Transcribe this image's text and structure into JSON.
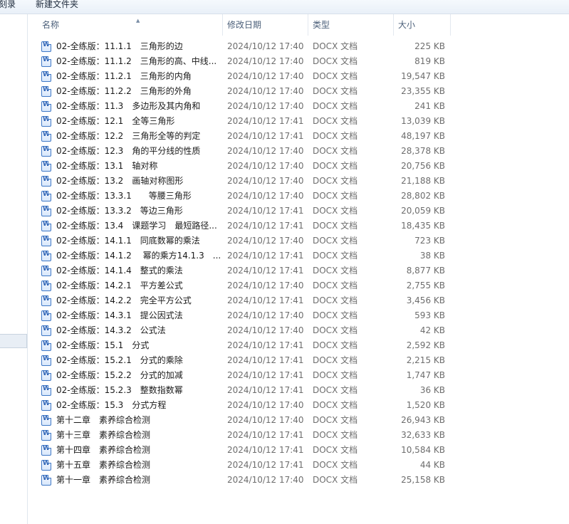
{
  "toolbar": {
    "burn_label": "刻录",
    "new_folder_label": "新建文件夹"
  },
  "columns": {
    "name": "名称",
    "date": "修改日期",
    "type": "类型",
    "size": "大小"
  },
  "icons": {
    "file": "docx-file-icon",
    "sort": "sort-ascending-icon"
  },
  "files": [
    {
      "name": "02-全练版：11.1.1　三角形的边",
      "date": "2024/10/12 17:40",
      "type": "DOCX 文档",
      "size": "225 KB",
      "icon": false
    },
    {
      "name": "02-全练版：11.1.2　三角形的高、中线...",
      "date": "2024/10/12 17:40",
      "type": "DOCX 文档",
      "size": "819 KB",
      "icon": false
    },
    {
      "name": "02-全练版：11.2.1　三角形的内角",
      "date": "2024/10/12 17:40",
      "type": "DOCX 文档",
      "size": "19,547 KB",
      "icon": false
    },
    {
      "name": "02-全练版：11.2.2　三角形的外角",
      "date": "2024/10/12 17:40",
      "type": "DOCX 文档",
      "size": "23,355 KB",
      "icon": false
    },
    {
      "name": "02-全练版：11.3　多边形及其内角和",
      "date": "2024/10/12 17:40",
      "type": "DOCX 文档",
      "size": "241 KB",
      "icon": false
    },
    {
      "name": "02-全练版：12.1　全等三角形",
      "date": "2024/10/12 17:41",
      "type": "DOCX 文档",
      "size": "13,039 KB",
      "icon": false
    },
    {
      "name": "02-全练版：12.2　三角形全等的判定",
      "date": "2024/10/12 17:41",
      "type": "DOCX 文档",
      "size": "48,197 KB",
      "icon": false
    },
    {
      "name": "02-全练版：12.3　角的平分线的性质",
      "date": "2024/10/12 17:40",
      "type": "DOCX 文档",
      "size": "28,378 KB",
      "icon": false
    },
    {
      "name": "02-全练版：13.1　轴对称",
      "date": "2024/10/12 17:40",
      "type": "DOCX 文档",
      "size": "20,756 KB",
      "icon": false
    },
    {
      "name": "02-全练版：13.2　画轴对称图形",
      "date": "2024/10/12 17:40",
      "type": "DOCX 文档",
      "size": "21,188 KB",
      "icon": false
    },
    {
      "name": "02-全练版：13.3.1　　等腰三角形",
      "date": "2024/10/12 17:40",
      "type": "DOCX 文档",
      "size": "28,802 KB",
      "icon": false
    },
    {
      "name": "02-全练版：13.3.2　等边三角形",
      "date": "2024/10/12 17:41",
      "type": "DOCX 文档",
      "size": "20,059 KB",
      "icon": false
    },
    {
      "name": "02-全练版：13.4　课题学习　最短路径...",
      "date": "2024/10/12 17:41",
      "type": "DOCX 文档",
      "size": "18,435 KB",
      "icon": false
    },
    {
      "name": "02-全练版：14.1.1　同底数幂的乘法",
      "date": "2024/10/12 17:40",
      "type": "DOCX 文档",
      "size": "723 KB",
      "icon": false
    },
    {
      "name": "02-全练版：14.1.2　 幂的乘方14.1.3　...",
      "date": "2024/10/12 17:41",
      "type": "DOCX 文档",
      "size": "38 KB",
      "icon": false
    },
    {
      "name": "02-全练版：14.1.4　整式的乘法",
      "date": "2024/10/12 17:41",
      "type": "DOCX 文档",
      "size": "8,877 KB",
      "icon": false
    },
    {
      "name": "02-全练版：14.2.1　平方差公式",
      "date": "2024/10/12 17:40",
      "type": "DOCX 文档",
      "size": "2,755 KB",
      "icon": false
    },
    {
      "name": "02-全练版：14.2.2　完全平方公式",
      "date": "2024/10/12 17:41",
      "type": "DOCX 文档",
      "size": "3,456 KB",
      "icon": false
    },
    {
      "name": "02-全练版：14.3.1　提公因式法",
      "date": "2024/10/12 17:40",
      "type": "DOCX 文档",
      "size": "593 KB",
      "icon": false
    },
    {
      "name": "02-全练版：14.3.2　公式法",
      "date": "2024/10/12 17:40",
      "type": "DOCX 文档",
      "size": "42 KB",
      "icon": false
    },
    {
      "name": "02-全练版：15.1　分式",
      "date": "2024/10/12 17:41",
      "type": "DOCX 文档",
      "size": "2,592 KB",
      "icon": false
    },
    {
      "name": "02-全练版：15.2.1　分式的乘除",
      "date": "2024/10/12 17:41",
      "type": "DOCX 文档",
      "size": "2,215 KB",
      "icon": false
    },
    {
      "name": "02-全练版：15.2.2　分式的加减",
      "date": "2024/10/12 17:41",
      "type": "DOCX 文档",
      "size": "1,747 KB",
      "icon": false
    },
    {
      "name": "02-全练版：15.2.3　整数指数幂",
      "date": "2024/10/12 17:41",
      "type": "DOCX 文档",
      "size": "36 KB",
      "icon": false
    },
    {
      "name": "02-全练版：15.3　分式方程",
      "date": "2024/10/12 17:40",
      "type": "DOCX 文档",
      "size": "1,520 KB",
      "icon": false
    },
    {
      "name": "第十二章　素养综合检测",
      "date": "2024/10/12 17:40",
      "type": "DOCX 文档",
      "size": "26,943 KB",
      "icon": false
    },
    {
      "name": "第十三章　素养综合检测",
      "date": "2024/10/12 17:41",
      "type": "DOCX 文档",
      "size": "32,633 KB",
      "icon": false
    },
    {
      "name": "第十四章　素养综合检测",
      "date": "2024/10/12 17:41",
      "type": "DOCX 文档",
      "size": "10,584 KB",
      "icon": false
    },
    {
      "name": "第十五章　素养综合检测",
      "date": "2024/10/12 17:41",
      "type": "DOCX 文档",
      "size": "44 KB",
      "icon": false
    },
    {
      "name": "第十一章　素养综合检测",
      "date": "2024/10/12 17:40",
      "type": "DOCX 文档",
      "size": "25,158 KB",
      "icon": false
    }
  ]
}
